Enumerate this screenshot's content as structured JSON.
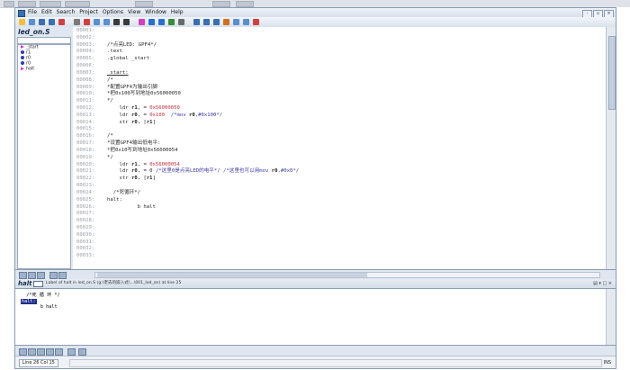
{
  "file_title": "led_on.S",
  "menu": [
    "File",
    "Edit",
    "Search",
    "Project",
    "Options",
    "View",
    "Window",
    "Help"
  ],
  "window_controls": [
    "-",
    "▫",
    "×"
  ],
  "symbols": [
    {
      "name": "_start",
      "kind": "fn"
    },
    {
      "name": "r1",
      "kind": "var"
    },
    {
      "name": "r0",
      "kind": "var"
    },
    {
      "name": "r0",
      "kind": "var"
    },
    {
      "name": "halt",
      "kind": "fn"
    }
  ],
  "code_lines": [
    {
      "no": "00001:",
      "text": ""
    },
    {
      "no": "00002:",
      "text": ""
    },
    {
      "no": "00003:",
      "text": "/*点亮LED: GPF4*/",
      "cls": "cm"
    },
    {
      "no": "00004:",
      "text": ".text"
    },
    {
      "no": "00005:",
      "text": ".global _start"
    },
    {
      "no": "00006:",
      "text": ""
    },
    {
      "no": "00007:",
      "text": "_start:",
      "cls": "kw-under"
    },
    {
      "no": "00008:",
      "text": "/*",
      "cls": "cm"
    },
    {
      "no": "00009:",
      "text": "*配置GPF4为输出引脚",
      "cls": "cm"
    },
    {
      "no": "00010:",
      "text": "*把0x100写到地址0x56000050",
      "cls": "cm"
    },
    {
      "no": "00011:",
      "text": "*/",
      "cls": "cm"
    },
    {
      "no": "00012:",
      "text": "    ldr r1, = 0x56000050",
      "cls": "ins"
    },
    {
      "no": "00013:",
      "text": "    ldr r0, = 0x100  /*mov r0,#0x100*/",
      "cls": "ins"
    },
    {
      "no": "00014:",
      "text": "    str r0, [r1]",
      "cls": "ins"
    },
    {
      "no": "00015:",
      "text": ""
    },
    {
      "no": "00016:",
      "text": "/*",
      "cls": "cm"
    },
    {
      "no": "00017:",
      "text": "*设置GPF4输出低电平:",
      "cls": "cm"
    },
    {
      "no": "00018:",
      "text": "*把0x10写到地址0x56000054",
      "cls": "cm"
    },
    {
      "no": "00019:",
      "text": "*/",
      "cls": "cm"
    },
    {
      "no": "00020:",
      "text": "    ldr r1, = 0x56000054",
      "cls": "ins"
    },
    {
      "no": "00021:",
      "text": "    ldr r0, = 0 /*这里0是点亮LED的电平*/ /*这里也可以用mov r0,#0x0*/",
      "cls": "ins"
    },
    {
      "no": "00022:",
      "text": "    str r0, [r1]",
      "cls": "ins"
    },
    {
      "no": "00023:",
      "text": ""
    },
    {
      "no": "00024:",
      "text": "  /*死循环*/",
      "cls": "cm"
    },
    {
      "no": "00025:",
      "text": "halt:",
      "cls": "kw-label"
    },
    {
      "no": "00026:",
      "text": "          b halt"
    },
    {
      "no": "00027:",
      "text": ""
    },
    {
      "no": "00028:",
      "text": ""
    },
    {
      "no": "00029:",
      "text": ""
    },
    {
      "no": "00030:",
      "text": ""
    },
    {
      "no": "00031:",
      "text": ""
    },
    {
      "no": "00032:",
      "text": ""
    },
    {
      "no": "00033:",
      "text": ""
    }
  ],
  "context": {
    "symbol": "halt",
    "info": "Label of halt in led_on.S (g:\\老去的嵌入式\\...\\001_led_on) at line 25",
    "controls": "▤ ▾ □ ×",
    "lines": [
      "  /*死 循 环 */",
      "halt:",
      "       b halt"
    ]
  },
  "status": {
    "line_col": "Line 26  Col 15",
    "mode": "INS"
  },
  "colors": {
    "label": "#c0303c",
    "comment": "#3a3aa8",
    "panel": "#dfe7f2",
    "frame": "#c9d5e6"
  }
}
